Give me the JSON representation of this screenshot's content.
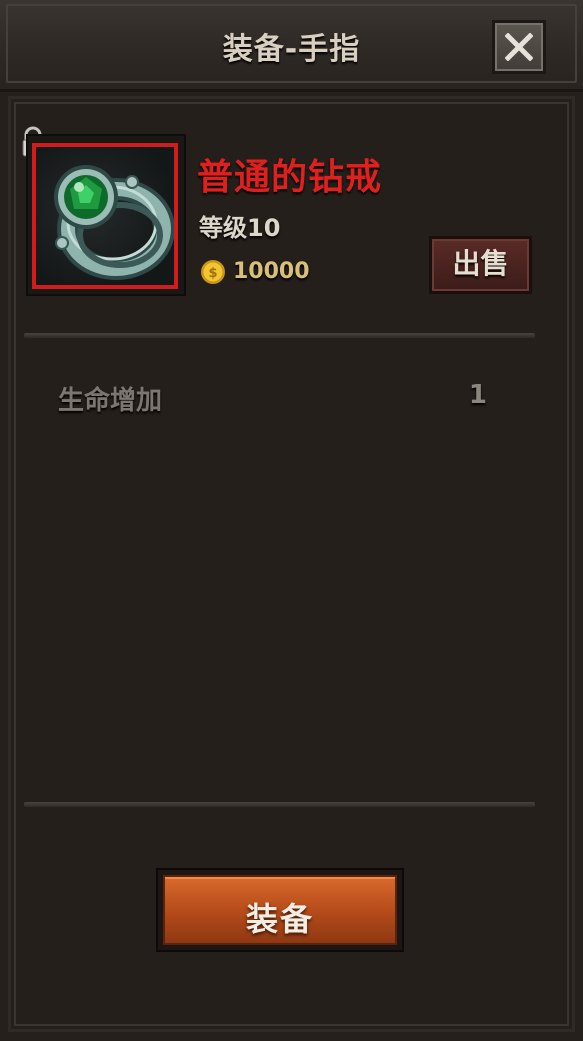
{
  "header": {
    "title": "装备-手指"
  },
  "item": {
    "name": "普通的钻戒",
    "level": "等级10",
    "price": "10000",
    "icon": "emerald-ring-icon",
    "rarity_color": "#d01c1c"
  },
  "actions": {
    "sell_label": "出售",
    "equip_label": "装备"
  },
  "stats": [
    {
      "label": "生命增加",
      "value": "1"
    }
  ],
  "colors": {
    "name": "#e01f1f",
    "price": "#d9c07a",
    "equip_button": "#c85a22"
  }
}
